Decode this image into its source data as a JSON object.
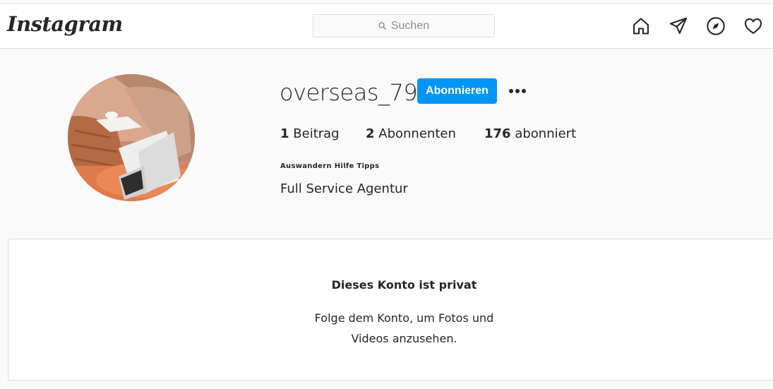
{
  "header": {
    "logo": "Instagram",
    "search": {
      "placeholder": "Suchen"
    },
    "nav_icons": [
      "home-icon",
      "direct-message-icon",
      "explore-icon",
      "activity-heart-icon"
    ]
  },
  "profile": {
    "username": "overseas_79",
    "follow_label": "Abonnieren",
    "more_icon": "more-options-icon",
    "stats": {
      "posts": {
        "count": "1",
        "label": "Beitrag"
      },
      "followers": {
        "count": "2",
        "label": "Abonnenten"
      },
      "following": {
        "count": "176",
        "label": "abonniert"
      }
    },
    "full_name": "𝗔𝘂𝘀𝘄𝗮𝗻𝗱𝗲𝗿𝗻 𝗛𝗶𝗹𝗳𝗲 𝗧𝗶𝗽𝗽𝘀",
    "bio": "Full Service Agentur"
  },
  "private_notice": {
    "title": "Dieses Konto ist privat",
    "line1": "Folge dem Konto, um Fotos und",
    "line2": "Videos anzusehen."
  },
  "colors": {
    "accent": "#0095f6",
    "border": "#dbdbdb",
    "background": "#fafafa",
    "text": "#262626"
  }
}
